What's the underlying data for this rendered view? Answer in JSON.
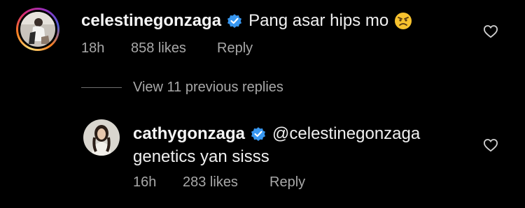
{
  "comments": [
    {
      "username": "celestinegonzaga",
      "text": "Pang asar hips mo",
      "emoji": "angry-face-emoji",
      "time": "18h",
      "likes": "858 likes",
      "reply": "Reply"
    },
    {
      "username": "cathygonzaga",
      "mention": "@celestinegonzaga",
      "text": "genetics yan sisss",
      "time": "16h",
      "likes": "283 likes",
      "reply": "Reply"
    }
  ],
  "view_replies": "View 11 previous replies",
  "colors": {
    "background": "#000000",
    "text": "#f5f5f5",
    "meta": "#a8a8a8",
    "verified": "#3897f0",
    "heart_outline": "#d0d0d0"
  }
}
